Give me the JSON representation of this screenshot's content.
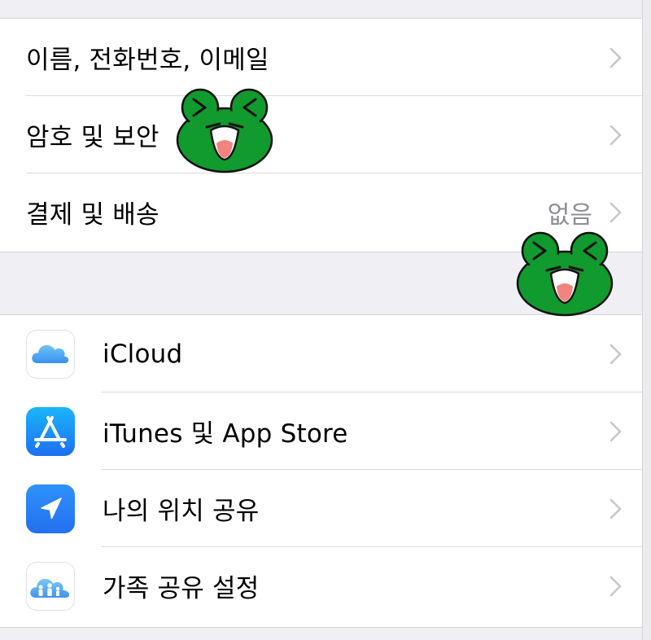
{
  "account_section": {
    "rows": [
      {
        "label": "이름, 전화번호, 이메일",
        "value": ""
      },
      {
        "label": "암호 및 보안",
        "value": ""
      },
      {
        "label": "결제 및 배송",
        "value": "없음"
      }
    ]
  },
  "services_section": {
    "rows": [
      {
        "label": "iCloud",
        "icon": "icloud-icon",
        "color": "#4aa6f5"
      },
      {
        "label": "iTunes 및 App Store",
        "icon": "app-store-icon",
        "color": "#1e6ff1"
      },
      {
        "label": "나의 위치 공유",
        "icon": "location-arrow-icon",
        "color": "#2f80f5"
      },
      {
        "label": "가족 공유 설정",
        "icon": "family-sharing-icon",
        "color": "#5ab0f0"
      }
    ]
  },
  "stickers": [
    {
      "icon": "laughing-frog-sticker",
      "color": "#119a2e"
    },
    {
      "icon": "laughing-frog-sticker",
      "color": "#119a2e"
    }
  ]
}
